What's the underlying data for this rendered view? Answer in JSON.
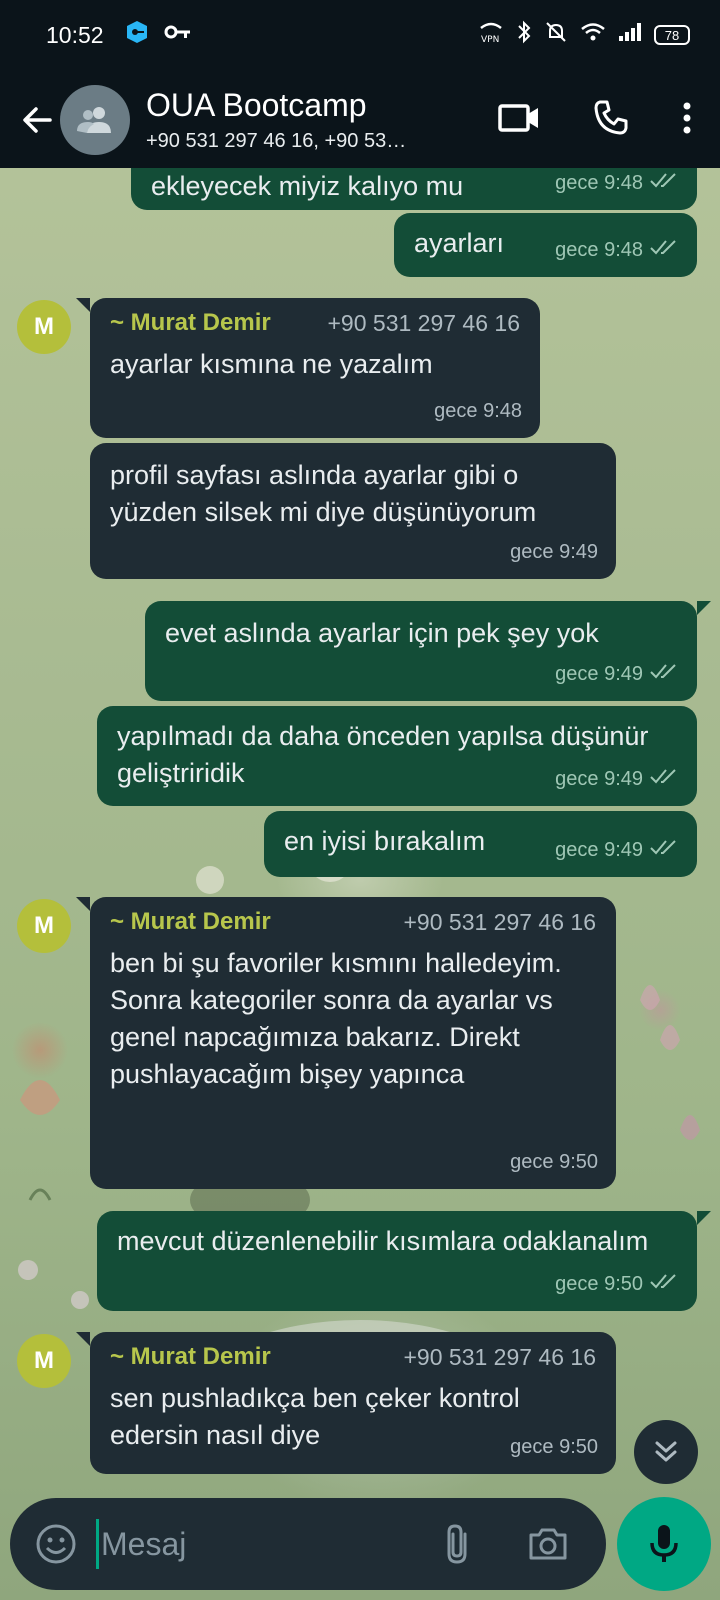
{
  "status_bar": {
    "time": "10:52",
    "battery": "78",
    "icons": [
      "vpn-key-icon",
      "key-icon",
      "vpn-icon",
      "bluetooth-icon",
      "bell-muted-icon",
      "wifi-icon",
      "signal-icon",
      "battery-icon"
    ]
  },
  "header": {
    "title": "OUA Bootcamp",
    "subtitle": "+90 531 297 46 16, +90 53…",
    "actions": [
      "video-call-icon",
      "phone-call-icon",
      "more-options-icon"
    ]
  },
  "messages": [
    {
      "direction": "out",
      "text": "ekleyecek miyiz kalıyo mu",
      "time": "gece 9:48"
    },
    {
      "direction": "out",
      "text": "ayarları",
      "time": "gece 9:48"
    },
    {
      "direction": "in",
      "sender": "~ Murat Demir",
      "phone": "+90 531 297 46 16",
      "avatar": "M",
      "text": "ayarlar kısmına ne yazalım",
      "time": "gece 9:48"
    },
    {
      "direction": "in",
      "text": "profil sayfası aslında ayarlar gibi o yüzden silsek mi diye düşünüyorum",
      "time": "gece 9:49"
    },
    {
      "direction": "out",
      "text": "evet aslında ayarlar için pek şey yok",
      "time": "gece 9:49"
    },
    {
      "direction": "out",
      "text": "yapılmadı da daha önceden yapılsa düşünür geliştriridik",
      "time": "gece 9:49"
    },
    {
      "direction": "out",
      "text": "en iyisi bırakalım",
      "time": "gece 9:49"
    },
    {
      "direction": "in",
      "sender": "~ Murat Demir",
      "phone": "+90 531 297 46 16",
      "avatar": "M",
      "text": "ben bi şu favoriler kısmını halledeyim. Sonra kategoriler sonra da ayarlar vs genel napcağımıza bakarız. Direkt pushlayacağım bişey yapınca",
      "time": "gece 9:50"
    },
    {
      "direction": "out",
      "text": "mevcut düzenlenebilir kısımlara odaklanalım",
      "time": "gece 9:50"
    },
    {
      "direction": "in",
      "sender": "~ Murat Demir",
      "phone": "+90 531 297 46 16",
      "avatar": "M",
      "text": "sen pushladıkça ben çeker kontrol edersin nasıl diye",
      "time": "gece 9:50"
    }
  ],
  "composer": {
    "placeholder": "Mesaj",
    "value": ""
  },
  "colors": {
    "header_bg": "#0b141a",
    "outgoing_bubble": "#134d37",
    "incoming_bubble": "#1f2c34",
    "sender_name": "#b7c64c",
    "accent": "#00a884"
  }
}
